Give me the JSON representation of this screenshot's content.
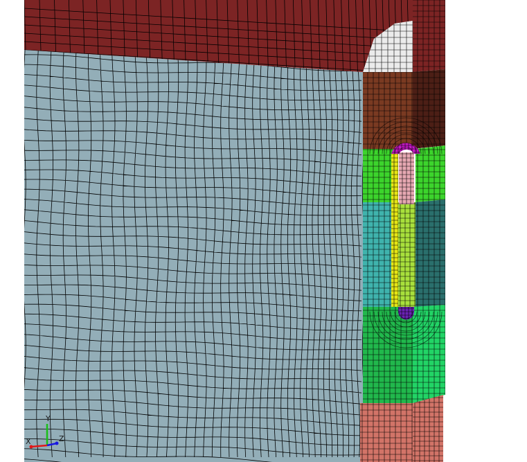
{
  "colors": {
    "background": "#ffffff",
    "main_part": "#93aeb8",
    "top_plate": "#7c2424",
    "corner_fillet": "#ebebeb",
    "brown_block": "#7a3a22",
    "dark_brown_block": "#4c1f16",
    "magenta_cap": "#c418c4",
    "pink_core": "#e6a8b2",
    "yellow_strip": "#e5e515",
    "green_block": "#3cd42c",
    "lime_block": "#a8e03c",
    "teal_block": "#3fb3ad",
    "dark_teal_block": "#2a6f6c",
    "bright_green_block": "#22d466",
    "mid_green_block": "#21b84c",
    "purple_cap": "#6a22b4",
    "salmon_block": "#d27468",
    "mesh_line": "#000000",
    "axis_x": "#e01818",
    "axis_y": "#18c018",
    "axis_z": "#1818e0"
  },
  "triad": {
    "y_label": "Y",
    "z_label": "Z",
    "x_label": "X"
  }
}
